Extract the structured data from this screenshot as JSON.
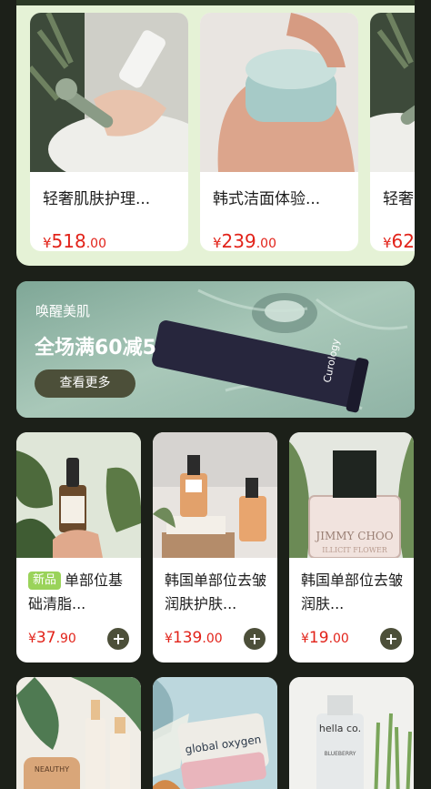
{
  "featured": [
    {
      "title": "轻奢肌肤护理...",
      "currency": "¥",
      "price_int": "518",
      "price_dec": ".00",
      "image": "lotion-hands-photo"
    },
    {
      "title": "韩式洁面体验...",
      "currency": "¥",
      "price_int": "239",
      "price_dec": ".00",
      "image": "cream-jar-photo"
    },
    {
      "title": "轻奢",
      "currency": "¥",
      "price_int": "62",
      "price_dec": "",
      "image": "lotion-hands-photo-partial"
    }
  ],
  "banner": {
    "subtitle": "唤醒美肌",
    "headline": "全场满60减5",
    "button_label": "查看更多",
    "tube_brand": "Curology"
  },
  "products": [
    {
      "tag": "新品",
      "title": "单部位基础清脂...",
      "currency": "¥",
      "price_int": "37",
      "price_dec": ".90",
      "image": "dropper-bottle-photo"
    },
    {
      "tag": "",
      "title": "韩国单部位去皱润肤护肤...",
      "currency": "¥",
      "price_int": "139",
      "price_dec": ".00",
      "image": "serum-bottles-photo"
    },
    {
      "tag": "",
      "title": "韩国单部位去皱润肤...",
      "currency": "¥",
      "price_int": "19",
      "price_dec": ".00",
      "image": "perfume-bottle-photo",
      "image_text": "JIMMY CHOO",
      "image_subtext": "ILLICIT FLOWER"
    },
    {
      "tag": "",
      "title": "",
      "image": "skincare-set-photo",
      "image_text": "NEAUTHY"
    },
    {
      "tag": "",
      "title": "",
      "image": "cream-tub-photo",
      "image_text": "global oxygen"
    },
    {
      "tag": "",
      "title": "",
      "image": "blueberry-bottle-photo",
      "image_text": "hella co.",
      "image_subtext": "BLUEBERRY"
    }
  ],
  "colors": {
    "price": "#e2231a",
    "accent": "#4c4f39",
    "tag": "#9ad35a",
    "panel": "#e5f2d6",
    "background": "#1c2019"
  },
  "icons": {
    "add": "plus-circle-icon"
  }
}
